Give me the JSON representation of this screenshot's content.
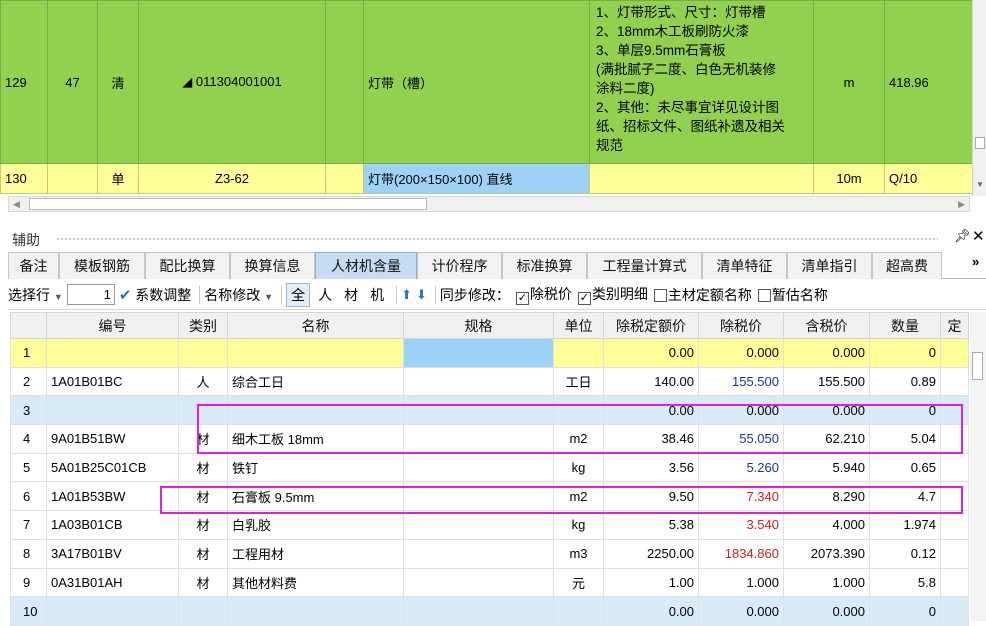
{
  "top_rows": [
    {
      "row_num": "129",
      "seq": "47",
      "type": "清",
      "code": "◢ 011304001001",
      "col5": "",
      "name": "灯带（槽）",
      "features": [
        "1、灯带形式、尺寸：灯带槽",
        "2、18mm木工板刷防火漆",
        "3、单层9.5mm石膏板",
        "(满批腻子二度、白色无机装修",
        "涂料二度)",
        "2、其他：未尽事宜详见设计图",
        "纸、招标文件、图纸补遗及相关",
        "规范"
      ],
      "unit": "m",
      "qty": "418.96"
    },
    {
      "row_num": "130",
      "seq": "",
      "type": "单",
      "code": "Z3-62",
      "col5": "",
      "name": "灯带(200×150×100) 直线",
      "features": [],
      "unit": "10m",
      "qty": "Q/10"
    }
  ],
  "aux": {
    "title": "辅助",
    "pin_icon": "pin-icon",
    "close_icon": "close-icon",
    "more": "»"
  },
  "tabs": [
    "备注",
    "模板钢筋",
    "配比换算",
    "换算信息",
    "人材机含量",
    "计价程序",
    "标准换算",
    "工程量计算式",
    "清单特征",
    "清单指引",
    "超高费"
  ],
  "active_tab": "人材机含量",
  "toolbar": {
    "select_row": "选择行",
    "row_input": "1",
    "coef_adjust": "系数调整",
    "name_modify": "名称修改",
    "filters": [
      "全",
      "人",
      "材",
      "机"
    ],
    "sync_label": "同步修改：",
    "opt_tax": "除税价",
    "opt_category": "类别明细",
    "opt_main_quota": "主材定额名称",
    "opt_temp_name": "暂估名称"
  },
  "columns": [
    "",
    "编号",
    "类别",
    "名称",
    "规格",
    "单位",
    "除税定额价",
    "除税价",
    "含税价",
    "数量",
    "定"
  ],
  "rows": [
    {
      "n": "1",
      "code": "",
      "cat": "",
      "name": "",
      "spec": "",
      "unit": "",
      "quota": "0.00",
      "price": "0.000",
      "tax_price": "0.000",
      "qty": "0"
    },
    {
      "n": "2",
      "code": "1A01B01BC",
      "cat": "人",
      "name": "综合工日",
      "spec": "",
      "unit": "工日",
      "quota": "140.00",
      "price": "155.500",
      "tax_price": "155.500",
      "qty": "0.89"
    },
    {
      "n": "3",
      "code": "",
      "cat": "",
      "name": "",
      "spec": "",
      "unit": "",
      "quota": "0.00",
      "price": "0.000",
      "tax_price": "0.000",
      "qty": "0"
    },
    {
      "n": "4",
      "code": "9A01B51BW",
      "cat": "材",
      "name": "细木工板 18mm",
      "spec": "",
      "unit": "m2",
      "quota": "38.46",
      "price": "55.050",
      "tax_price": "62.210",
      "qty": "5.04"
    },
    {
      "n": "5",
      "code": "5A01B25C01CB",
      "cat": "材",
      "name": "铁钉",
      "spec": "",
      "unit": "kg",
      "quota": "3.56",
      "price": "5.260",
      "tax_price": "5.940",
      "qty": "0.65"
    },
    {
      "n": "6",
      "code": "1A01B53BW",
      "cat": "材",
      "name": "石膏板 9.5mm",
      "spec": "",
      "unit": "m2",
      "quota": "9.50",
      "price": "7.340",
      "tax_price": "8.290",
      "qty": "4.7"
    },
    {
      "n": "7",
      "code": "1A03B01CB",
      "cat": "材",
      "name": "白乳胶",
      "spec": "",
      "unit": "kg",
      "quota": "5.38",
      "price": "3.540",
      "tax_price": "4.000",
      "qty": "1.974"
    },
    {
      "n": "8",
      "code": "3A17B01BV",
      "cat": "材",
      "name": "工程用材",
      "spec": "",
      "unit": "m3",
      "quota": "2250.00",
      "price": "1834.860",
      "tax_price": "2073.390",
      "qty": "0.12"
    },
    {
      "n": "9",
      "code": "0A31B01AH",
      "cat": "材",
      "name": "其他材料费",
      "spec": "",
      "unit": "元",
      "quota": "1.00",
      "price": "1.000",
      "tax_price": "1.000",
      "qty": "5.8"
    },
    {
      "n": "10",
      "code": "",
      "cat": "",
      "name": "",
      "spec": "",
      "unit": "",
      "quota": "0.00",
      "price": "0.000",
      "tax_price": "0.000",
      "qty": "0"
    }
  ],
  "colors": {
    "green_row": "#92d050",
    "yellow_row": "#ffff99",
    "blue_cell": "#9dd2f7",
    "highlight": "#e020e0",
    "price_blue": "#1a2fb0",
    "price_red": "#d02020"
  }
}
